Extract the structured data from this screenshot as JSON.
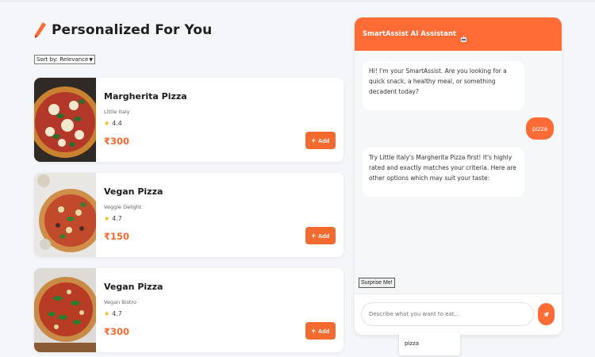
{
  "page": {
    "heading": "Personalized For You",
    "sort_label": "Sort by: Relevance"
  },
  "dishes": [
    {
      "name": "Margherita Pizza",
      "restaurant": "Little Italy",
      "rating": "4.4",
      "price": "₹300",
      "add_label": "Add"
    },
    {
      "name": "Vegan Pizza",
      "restaurant": "Veggie Delight",
      "rating": "4.7",
      "price": "₹150",
      "add_label": "Add"
    },
    {
      "name": "Vegan Pizza",
      "restaurant": "Vegan Bistro",
      "rating": "4.7",
      "price": "₹300",
      "add_label": "Add"
    }
  ],
  "chat": {
    "title": "SmartAssist AI Assistant",
    "messages": [
      {
        "from": "bot",
        "text": "Hi! I'm your SmartAssist. Are you looking for a quick snack, a healthy meal, or something decadent today?"
      },
      {
        "from": "user",
        "text": "pizza"
      },
      {
        "from": "bot",
        "text": "Try Little Italy's Margherita Pizza first! It's highly rated and exactly matches your criteria. Here are other options which may suit your taste:"
      }
    ],
    "surprise_label": "Surprise Me!",
    "input_placeholder": "Describe what you want to eat...",
    "suggestion": "pizza"
  },
  "colors": {
    "accent": "#ff6b35",
    "price": "#f26a2e",
    "star": "#f4b400"
  }
}
